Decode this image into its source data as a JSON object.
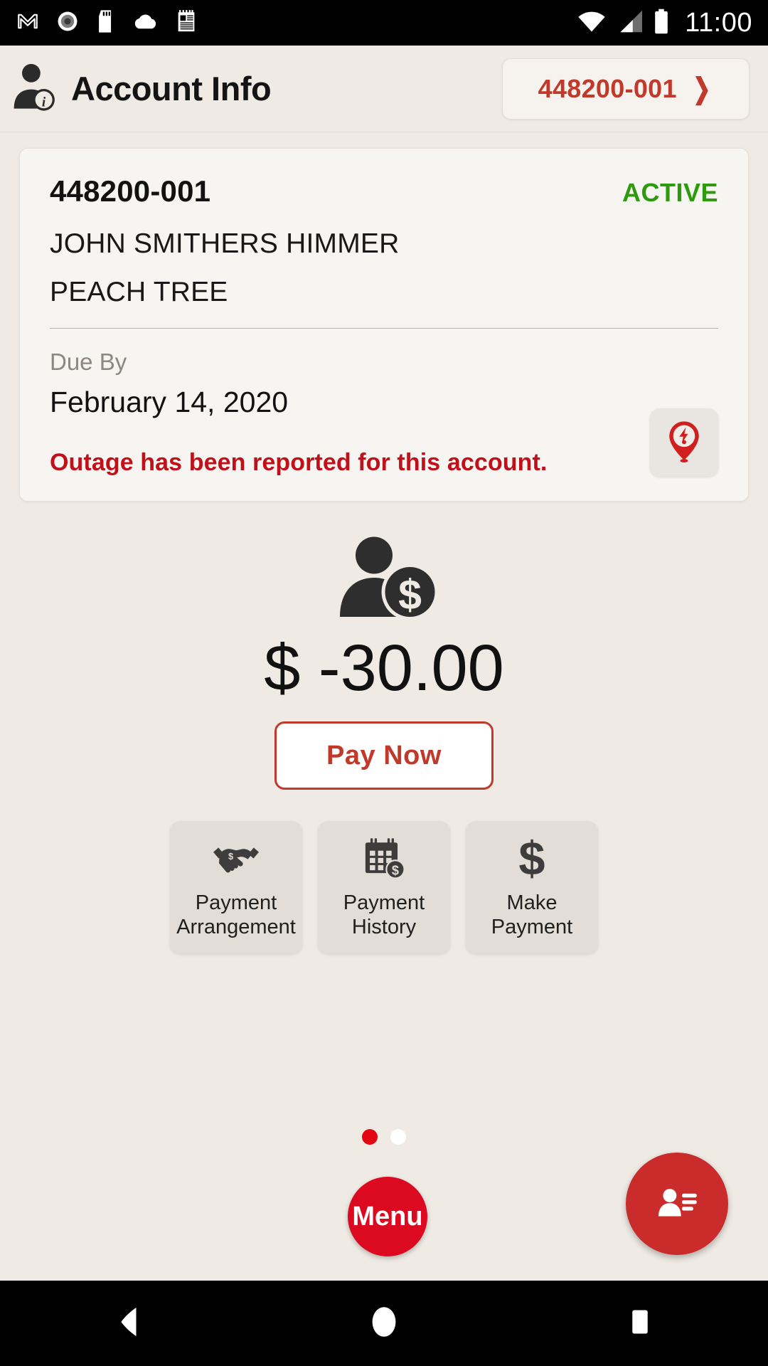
{
  "status_bar": {
    "clock": "11:00",
    "left_icons": [
      {
        "name": "gmail-icon"
      },
      {
        "name": "record-circle-icon"
      },
      {
        "name": "sd-card-icon"
      },
      {
        "name": "cloud-icon"
      },
      {
        "name": "notepad-icon"
      }
    ],
    "right_icons": [
      {
        "name": "wifi-icon"
      },
      {
        "name": "cellular-signal-icon"
      },
      {
        "name": "battery-icon"
      }
    ]
  },
  "header": {
    "title": "Account Info",
    "account_pill": {
      "label": "448200-001",
      "chevron": "❯"
    }
  },
  "account_card": {
    "account_number": "448200-001",
    "status": "ACTIVE",
    "customer_name": "JOHN SMITHERS HIMMER",
    "address": "PEACH TREE",
    "due_by_label": "Due By",
    "due_by_date": "February 14, 2020",
    "outage_message": "Outage has been reported for this account."
  },
  "balance": {
    "amount": "$ -30.00",
    "pay_now_label": "Pay Now"
  },
  "tiles": [
    {
      "label": "Payment\nArrangement",
      "icon": "handshake-dollar-icon"
    },
    {
      "label": "Payment\nHistory",
      "icon": "calendar-dollar-icon"
    },
    {
      "label": "Make\nPayment",
      "icon": "dollar-sign-icon"
    }
  ],
  "pagination": {
    "total": 2,
    "active_index": 0
  },
  "menu_fab": {
    "label": "Menu"
  },
  "contact_fab": {
    "icon": "contact-card-icon"
  },
  "nav_bar": {
    "back": "back-triangle-icon",
    "home": "home-circle-icon",
    "recents": "recents-square-icon"
  },
  "colors": {
    "page_background": "#EFEAE4",
    "card_background": "#F7F5F1",
    "brand_red": "#C0392B",
    "fab_red": "#DB0A20",
    "active_green": "#2E9B0E",
    "outage_red": "#C0111B",
    "tile_background": "#E3DDD7"
  }
}
